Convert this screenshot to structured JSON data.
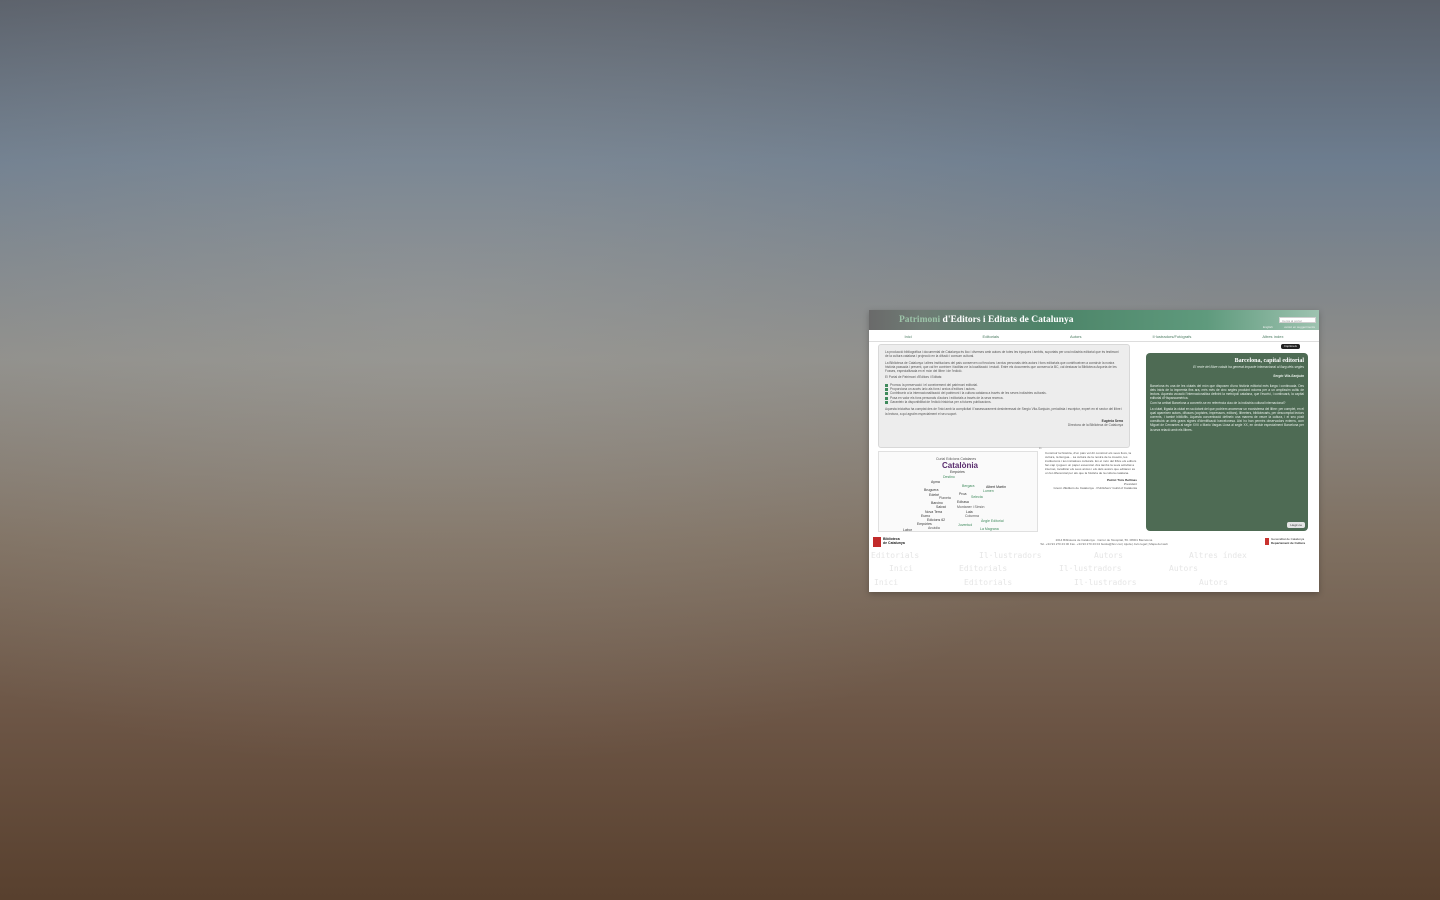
{
  "header": {
    "title_part1": "Patrimoni",
    "title_part2": " d'Editors i Editats de Catalunya",
    "search_placeholder": "Cerca al portal",
    "lang_en": "English",
    "lang_other": "versió en suggeriments"
  },
  "nav": [
    "Inici",
    "Editorials",
    "Autors",
    "Il·lustradors/Fotògrafs",
    "Altres índex"
  ],
  "print_label": "Imprimeix",
  "intro": {
    "p1": "La producció bibliogràfica i documental de Catalunya és lloc i diverses amb autors de totes les èpoques i àmbits, suportats per una indústria editorial que és testimoni de la cultura catalana i projecció en la difusió i consum cultural.",
    "p2": "La Biblioteca de Catalunya i altres institucions del país conserven col·leccions i arxius personals dels autors i fons editorials que contribueixen a construir la nostra història passada i present, que cal fer conèixer i facilitar-ne la localització i estudi. Entre els documents que conserva la BC, cal destacar la Biblioteca Arqueta de les Fosses, especialitzada en el món del llibre i de l'edició.",
    "p3": "El Portal de Patrimoni d'Editors i Editats:",
    "bullets": [
      "Promou la preservació i el coneixement del patrimoni editorial.",
      "Proporciona un accés únic als fons i arxius d'editors i autors.",
      "Contribueix a la internacionalització del patrimoni i la cultura catalana a través de les seves indústries culturals.",
      "Posa en valor els fons personals d'autors i editorials a través de la seva recerca.",
      "Garanteix la disponibilitat de l'edició històrica per a futures publicacions."
    ],
    "p4": "Aquesta iniciativa ha comptat des de l'inici amb la complicitat i l'assessorament desinteressat de Sergio Vila-Sanjuán, periodista i escriptor, expert en el sector del llibre i la lectura, a qui agraïm especialment el seu suport.",
    "sig_name": "Eugènia Serra",
    "sig_role": "Directora de la Biblioteca de Catalunya"
  },
  "cloud": [
    "Curial Edicions Catalanes",
    "Catalònia",
    "Empúries",
    "Destino",
    "Ayma",
    "Bergara",
    "Albert Martín",
    "Lumen",
    "Bruguera",
    "Edebé",
    "Proa",
    "Planeta",
    "Selecta",
    "Barcino",
    "Edhasa",
    "Salvat",
    "Montaner i Simón",
    "Nova Terra",
    "Laia",
    "Eumo",
    "Columna",
    "Edicions 62",
    "Empúries",
    "Arcàdia",
    "Labor",
    "Juventud",
    "Àngle Editorial",
    "La Magrana",
    "Edicions Proa",
    "Aymà",
    "Antoni López",
    "Edicions de la Rosa Vera",
    "Fontana",
    "Bergnes",
    "Seix Barral",
    "Plaza & Janés",
    "Josep Janés",
    "Angle Editorial",
    "Anagrama",
    "Penguin Random House Grupo Editorial",
    "Edicions Destino",
    "Galàxia",
    "Ediciones Lumen",
    "La Campana"
  ],
  "quote": {
    "text": "Construir la història, d'un país vol dir construir els seus llocs, la cultura, la llengua... La cultura de la nostra de la creació, les institucions i les iniciatives culturals. En el món del llibre els editors fan cap i juguen un paper essencial. Ara també la seva activitat a internet, localitzar els seus arxius i els dels autors que editaren és un fet diferencial per als que la història de la cultura catalana.",
    "name": "Patrici Tixis Bellmas",
    "role": "President",
    "org": "Gremi d'Editors de Catalunya · Publishers' Guild of Catalonia"
  },
  "feature": {
    "title": "Barcelona, capital editorial",
    "subtitle": "El recte del llibre català ha generat impacte internacional al llarg dels segles",
    "author": "Sergio Vila-Sanjuán",
    "p1": "Barcelona és una de les ciutats del món que disposen d'una història editorial més llarga i continuada. Des dels inicis de la impremta fins ara, més més de cinc segles produint volums per a un amplíssim cultiu de lectors. Aquesta vocació l'internacionalitza definint la metròpoli catalana, que l'escriví, i continuarà, la capital editorial d'Hispanoamèrica.",
    "p2": "Com ha arribat Barcelona a convertir-se en referència clau de la indústria cultural internacional?",
    "p3": "La ciutat, lligada la ciutat en sa dotant del que podríem anomenar un ecosistema del llibre: per complet, en el qual apareixen autors, difusors (copistes, impressors, editors), llibreters, bibliotecaris, per descomptat lectors corrents, i també bibliòfils. Aquesta concentració defineix una manera de veure la cultura, i el seu pòsit constituirà un dels grans signes d'identificació barcelonesa. Així ho han permès observadors externs, com Miguel de Cervantes al segle XVII o Mario Vargas Llosa al segle XX, en deduir especialment Barcelona per la seva relació amb els llibres.",
    "more": "Llegir-ne"
  },
  "footer": {
    "bc_line1": "Biblioteca",
    "bc_line2": "de Catalunya",
    "addr1": "2014 Biblioteca de Catalunya · Carrer de l'Hospital, 56. 08001 Barcelona",
    "addr2": "Tel. +34 93 270 23 00 Fax. +34 93 270 23 04 bustia@bnc.cat | Ajuda | Avís legal | Mapa del web",
    "gen1": "Generalitat de Catalunya",
    "gen2": "Departament de Cultura"
  },
  "ghost_words": [
    "Editorials",
    "Il·lustradors",
    "Autors",
    "Altres índex",
    "Inici",
    "Editorials",
    "Il·lustradors",
    "Autors",
    "Inici",
    "Editorials",
    "Il·lustradors",
    "Autors"
  ]
}
